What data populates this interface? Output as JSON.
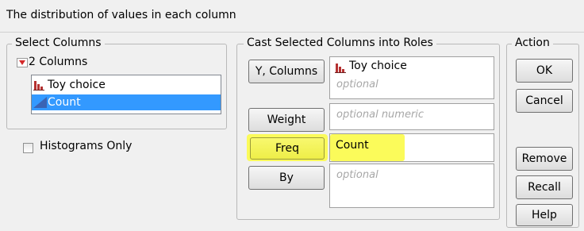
{
  "header": {
    "title": "The distribution of values in each column"
  },
  "select_columns": {
    "legend": "Select Columns",
    "count_label": "2 Columns",
    "items": [
      {
        "label": "Toy choice",
        "icon": "bar-chart-icon",
        "selected": false
      },
      {
        "label": "Count",
        "icon": "continuous-triangle-icon",
        "selected": true
      }
    ]
  },
  "options": {
    "histograms_only": "Histograms Only"
  },
  "cast": {
    "legend": "Cast Selected Columns into Roles",
    "roles": [
      {
        "button": "Y, Columns",
        "value": "Toy choice",
        "placeholder": "optional"
      },
      {
        "button": "Weight",
        "value": "",
        "placeholder": "optional numeric"
      },
      {
        "button": "Freq",
        "value": "Count",
        "placeholder": ""
      },
      {
        "button": "By",
        "value": "",
        "placeholder": "optional"
      }
    ]
  },
  "action": {
    "legend": "Action",
    "ok": "OK",
    "cancel": "Cancel",
    "remove": "Remove",
    "recall": "Recall",
    "help": "Help"
  },
  "colors": {
    "selection": "#3399ff",
    "highlight": "#fbfb5a",
    "bar_icon": "#b53232",
    "triangle_icon": "#3a63b5",
    "toggle_icon": "#d42a2a"
  }
}
